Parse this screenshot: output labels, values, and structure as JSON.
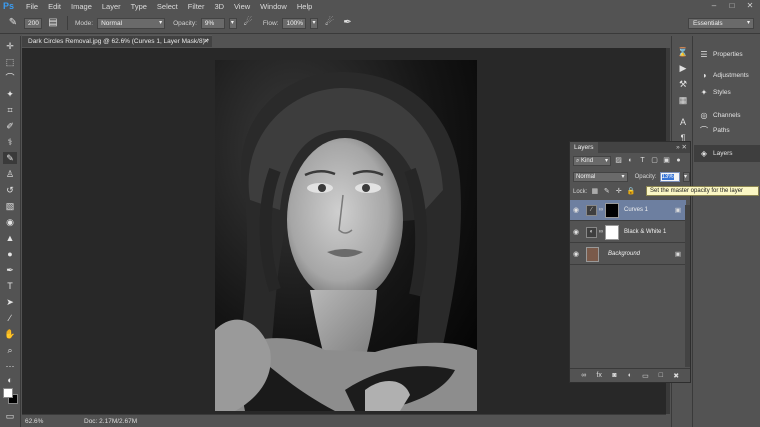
{
  "app": {
    "logo": "Ps"
  },
  "menu": [
    "File",
    "Edit",
    "Image",
    "Layer",
    "Type",
    "Select",
    "Filter",
    "3D",
    "View",
    "Window",
    "Help"
  ],
  "window_controls": [
    "–",
    "□",
    "✕"
  ],
  "options_bar": {
    "brush_size": "200",
    "mode_label": "Mode:",
    "mode_value": "Normal",
    "opacity_label": "Opacity:",
    "opacity_value": "9%",
    "flow_label": "Flow:",
    "flow_value": "100%",
    "workspace": "Essentials"
  },
  "document": {
    "tab_title": "Dark Circles Removal.jpg @ 62.6% (Curves 1, Layer Mask/8) *",
    "zoom": "62.6%",
    "doc_size": "Doc: 2.17M/2.67M"
  },
  "right_panels": [
    {
      "label": "Properties",
      "icon": "properties-icon"
    },
    {
      "label": "Adjustments",
      "icon": "adjustments-icon"
    },
    {
      "label": "Styles",
      "icon": "styles-icon"
    },
    {
      "label": "Channels",
      "icon": "channels-icon"
    },
    {
      "label": "Paths",
      "icon": "paths-icon"
    },
    {
      "label": "Layers",
      "icon": "layers-icon"
    }
  ],
  "layers_panel": {
    "tab_label": "Layers",
    "filter_kind": "Kind",
    "blend_mode": "Normal",
    "opacity_label": "Opacity:",
    "opacity_value": "13%",
    "lock_label": "Lock:",
    "tooltip": "Set the master opacity for the layer",
    "layers": [
      {
        "name": "Curves 1",
        "selected": true
      },
      {
        "name": "Black & White 1",
        "selected": false
      },
      {
        "name": "Background",
        "selected": false
      }
    ]
  }
}
